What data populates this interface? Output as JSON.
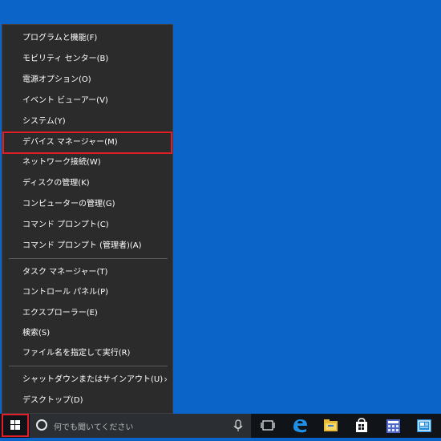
{
  "start_menu": {
    "items": [
      {
        "label": "プログラムと機能(F)"
      },
      {
        "label": "モビリティ センター(B)"
      },
      {
        "label": "電源オプション(O)"
      },
      {
        "label": "イベント ビューアー(V)"
      },
      {
        "label": "システム(Y)"
      },
      {
        "label": "デバイス マネージャー(M)",
        "highlighted": true
      },
      {
        "label": "ネットワーク接続(W)"
      },
      {
        "label": "ディスクの管理(K)"
      },
      {
        "label": "コンピューターの管理(G)"
      },
      {
        "label": "コマンド プロンプト(C)"
      },
      {
        "label": "コマンド プロンプト (管理者)(A)"
      },
      {
        "label": "タスク マネージャー(T)"
      },
      {
        "label": "コントロール パネル(P)"
      },
      {
        "label": "エクスプローラー(E)"
      },
      {
        "label": "検索(S)"
      },
      {
        "label": "ファイル名を指定して実行(R)"
      },
      {
        "label": "シャットダウンまたはサインアウト(U)"
      },
      {
        "label": "デスクトップ(D)"
      }
    ]
  },
  "taskbar": {
    "search_placeholder": "何でも聞いてください",
    "icons": [
      "windows-start-icon",
      "cortana-circle-icon",
      "microphone-icon",
      "task-view-icon",
      "edge-icon",
      "file-explorer-icon",
      "store-icon",
      "calculator-app-icon",
      "photo-app-icon"
    ]
  },
  "colors": {
    "desktop": "#0b64c8",
    "menu_bg": "#2b2b2b",
    "highlight": "#e11d2a",
    "taskbar": "#101418"
  }
}
